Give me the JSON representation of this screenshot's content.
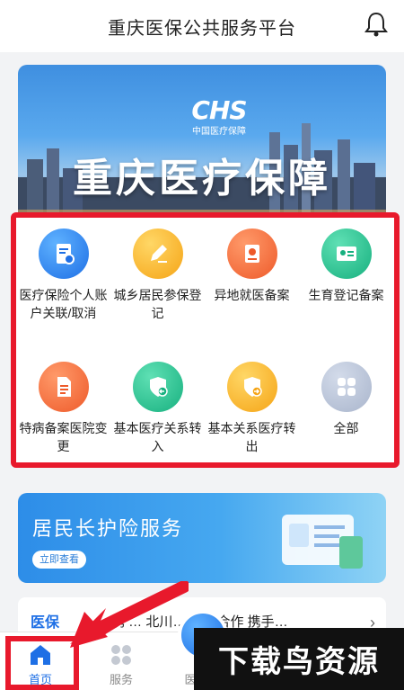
{
  "header": {
    "title": "重庆医保公共服务平台",
    "bell_icon": "bell-icon"
  },
  "banner": {
    "logo_mark": "CHS",
    "logo_sub": "中国医疗保障",
    "headline": "重庆医疗保障"
  },
  "services": [
    {
      "label": "医疗保险个人账户关联/取消",
      "icon": "account-link-icon",
      "color": "#1e6fe5"
    },
    {
      "label": "城乡居民参保登记",
      "icon": "pencil-icon",
      "color": "#f5a416"
    },
    {
      "label": "异地就医备案",
      "icon": "location-icon",
      "color": "#ee5a2a"
    },
    {
      "label": "生育登记备案",
      "icon": "id-card-icon",
      "color": "#17b07f"
    },
    {
      "label": "特病备案医院变更",
      "icon": "document-icon",
      "color": "#ee5a2a"
    },
    {
      "label": "基本医疗关系转入",
      "icon": "shield-in-icon",
      "color": "#17b07f"
    },
    {
      "label": "基本关系医疗转出",
      "icon": "shield-out-icon",
      "color": "#f5a416"
    },
    {
      "label": "全部",
      "icon": "grid-icon",
      "color": "#a9b5cc"
    }
  ],
  "promo": {
    "title": "居民长护险服务",
    "button": "立即查看"
  },
  "news": {
    "tag": "医保",
    "text": "携 … 北川… 战略合作 携手…",
    "chevron": "›"
  },
  "tabbar": {
    "tabs": [
      {
        "label": "首页",
        "icon": "home-icon",
        "active": true
      },
      {
        "label": "服务",
        "icon": "service-grid-icon",
        "active": false
      },
      {
        "label": "医保电",
        "icon": "ecard-icon",
        "active": false
      }
    ]
  },
  "watermark": "下载鸟资源",
  "colors": {
    "accent": "#1e6fe5",
    "highlight": "#e8192c"
  }
}
